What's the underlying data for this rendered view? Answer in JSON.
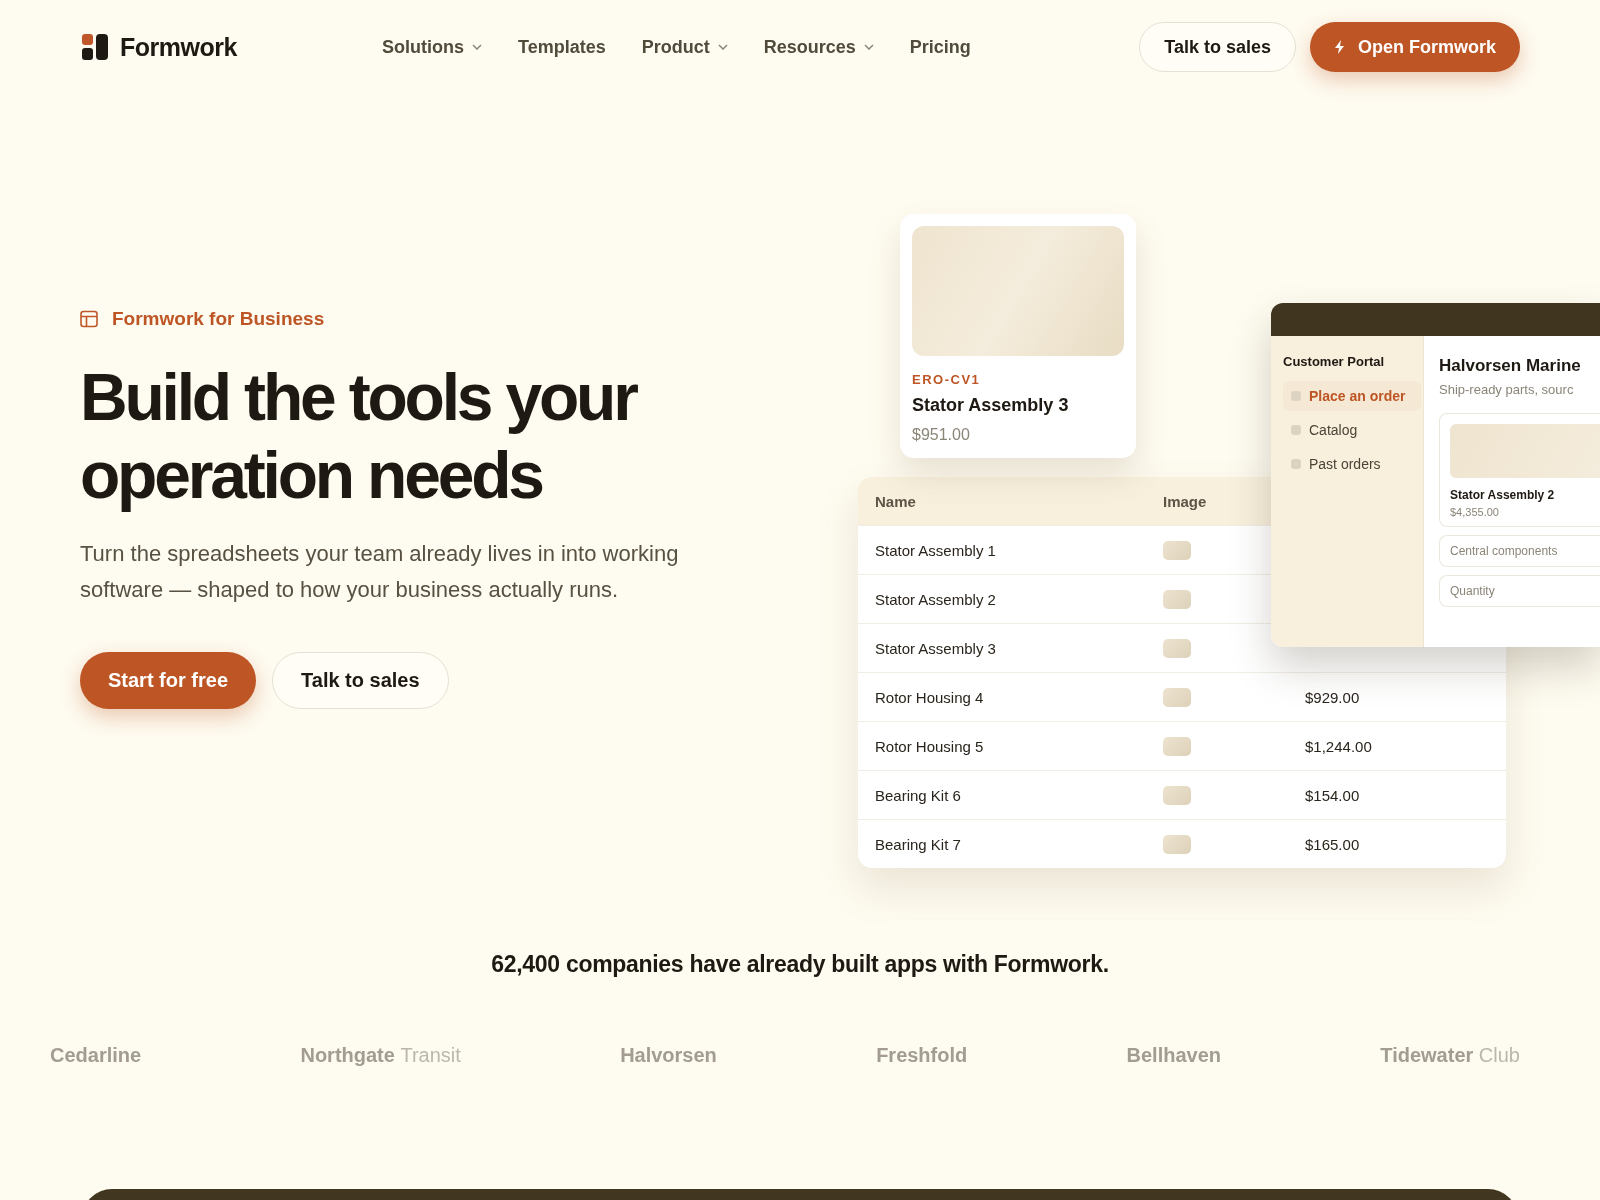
{
  "brand": {
    "name": "Formwork"
  },
  "nav": [
    {
      "label": "Solutions",
      "has_menu": true
    },
    {
      "label": "Templates",
      "has_menu": false
    },
    {
      "label": "Product",
      "has_menu": true
    },
    {
      "label": "Resources",
      "has_menu": true
    },
    {
      "label": "Pricing",
      "has_menu": false
    }
  ],
  "header_actions": [
    {
      "label": "Talk to sales",
      "kind": "secondary"
    },
    {
      "label": "Open Formwork",
      "kind": "primary"
    }
  ],
  "hero": {
    "eyebrow": "Formwork for Business",
    "title": "Build the tools your operation needs",
    "description": "Turn the spreadsheets your team already lives in into working software — shaped to how your business actually runs.",
    "actions": [
      {
        "label": "Start for free",
        "kind": "primary"
      },
      {
        "label": "Talk to sales",
        "kind": "secondary"
      }
    ]
  },
  "product_card": {
    "sku": "ERO-CV1",
    "name": "Stator Assembly 3",
    "price": "$951.00"
  },
  "table": {
    "columns": [
      "Name",
      "Image"
    ],
    "rows": [
      {
        "name": "Stator Assembly 1"
      },
      {
        "name": "Stator Assembly 2"
      },
      {
        "name": "Stator Assembly 3"
      },
      {
        "name": "Rotor Housing 4",
        "price": "$929.00"
      },
      {
        "name": "Rotor Housing 5",
        "price": "$1,244.00"
      },
      {
        "name": "Bearing Kit 6",
        "price": "$154.00"
      },
      {
        "name": "Bearing Kit 7",
        "price": "$165.00"
      }
    ]
  },
  "portal": {
    "title": "Customer Portal",
    "items": [
      {
        "label": "Place an order",
        "selected": true
      },
      {
        "label": "Catalog",
        "selected": false
      },
      {
        "label": "Past orders",
        "selected": false
      }
    ],
    "heading": "Halvorsen Marine",
    "subtitle": "Ship-ready parts, sourc",
    "card": {
      "name": "Stator Assembly 2",
      "price": "$4,355.00"
    },
    "fields": [
      {
        "placeholder": "Central components"
      },
      {
        "placeholder": "Quantity"
      }
    ]
  },
  "social_proof": "62,400 companies have already built apps with Formwork.",
  "logos": [
    {
      "name": "Cedarline"
    },
    {
      "name": "Northgate",
      "suffix": "Transit"
    },
    {
      "name": "Halvorsen"
    },
    {
      "name": "Freshfold"
    },
    {
      "name": "Bellhaven"
    },
    {
      "name": "Tidewater",
      "suffix": "Club"
    }
  ]
}
